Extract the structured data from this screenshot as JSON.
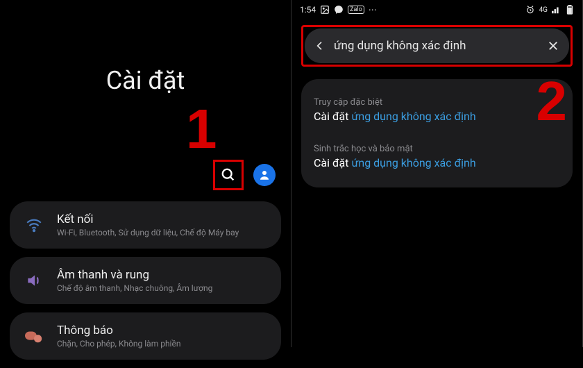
{
  "left": {
    "title": "Cài đặt",
    "annotation": "1",
    "items": [
      {
        "title": "Kết nối",
        "sub": "Wi-Fi, Bluetooth, Sử dụng dữ liệu, Chế độ Máy bay"
      },
      {
        "title": "Âm thanh và rung",
        "sub": "Chế độ âm thanh, Nhạc chuông, Âm lượng"
      },
      {
        "title": "Thông báo",
        "sub": "Chặn, Cho phép, Không làm phiền"
      }
    ]
  },
  "right": {
    "status": {
      "time": "1:54",
      "signal": "4G"
    },
    "search_query": "ứng dụng không xác định",
    "annotation": "2",
    "results": [
      {
        "crumb": "Truy cập đặc biệt",
        "prefix": "Cài đặt ",
        "hl": "ứng dụng không xác định"
      },
      {
        "crumb": "Sinh trắc học và bảo mật",
        "prefix": "Cài đặt ",
        "hl": "ứng dụng không xác định"
      }
    ]
  }
}
